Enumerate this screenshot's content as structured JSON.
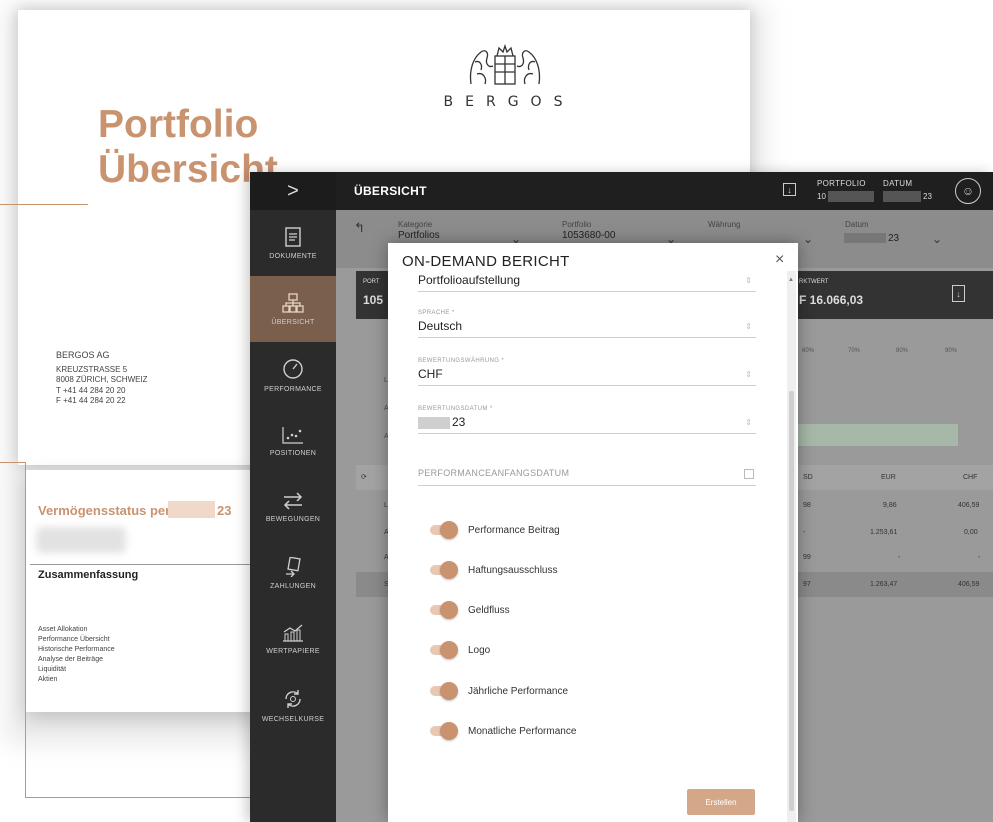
{
  "document": {
    "title_line1": "Portfolio",
    "title_line2": "Übersicht",
    "brand": "BERGOS",
    "address": {
      "firm": "BERGOS AG",
      "street": "KREUZSTRASSE 5",
      "city": "8008 ZÜRICH, SCHWEIZ",
      "phone": "T +41 44 284 20 20",
      "fax": "F +41 44 284 20 22"
    },
    "status_title": "Vermögensstatus per",
    "status_suffix": "23",
    "summary_title": "Zusammenfassung",
    "summary_items": [
      "Asset Allokation",
      "Performance Übersicht",
      "Historische Performance",
      "Analyse der Beiträge",
      "Liquidität",
      "Aktien"
    ]
  },
  "app": {
    "sidebar": {
      "toggle": ">",
      "items": [
        {
          "label": "DOKUMENTE",
          "icon": "document-icon"
        },
        {
          "label": "ÜBERSICHT",
          "icon": "sitemap-icon",
          "active": true
        },
        {
          "label": "PERFORMANCE",
          "icon": "gauge-icon"
        },
        {
          "label": "POSITIONEN",
          "icon": "scatter-icon"
        },
        {
          "label": "BEWEGUNGEN",
          "icon": "transfer-icon"
        },
        {
          "label": "ZAHLUNGEN",
          "icon": "payments-icon"
        },
        {
          "label": "WERTPAPIERE",
          "icon": "chart-icon"
        },
        {
          "label": "WECHSELKURSE",
          "icon": "exchange-icon"
        }
      ]
    },
    "topbar": {
      "title": "ÜBERSICHT",
      "portfolio_label": "PORTFOLIO",
      "portfolio_value": "10",
      "date_label": "DATUM",
      "date_value": "23"
    },
    "filters": {
      "category_label": "Kategorie",
      "category_value": "Portfolios",
      "portfolio_label": "Portfolio",
      "portfolio_value": "1053680-00",
      "currency_label": "Währung",
      "date_label": "Datum",
      "date_value": "23"
    },
    "card": {
      "left_label": "PORT",
      "left_value": "105",
      "right_label": "RKTWERT",
      "right_value": "F 16.066,03"
    },
    "behind": {
      "ticks": [
        "60%",
        "70%",
        "80%",
        "90%"
      ],
      "row_letters": [
        "L",
        "A",
        "A"
      ],
      "table_headers": [
        "SD",
        "EUR",
        "CHF"
      ],
      "rows": [
        {
          "k": "L",
          "a": "98",
          "b": "9,86",
          "c": "406,59"
        },
        {
          "k": "A",
          "a": "-",
          "b": "1.253,61",
          "c": "0,00"
        },
        {
          "k": "A",
          "a": "99",
          "b": "-",
          "c": "-"
        },
        {
          "k": "S",
          "a": "97",
          "b": "1.263,47",
          "c": "406,59"
        }
      ]
    }
  },
  "modal": {
    "title": "ON-DEMAND BERICHT",
    "close": "×",
    "fields": {
      "layout_value": "Portfolioaufstellung",
      "language_label": "SPRACHE *",
      "language_value": "Deutsch",
      "currency_label": "BEWERTUNGSWÄHRUNG *",
      "currency_value": "CHF",
      "valuation_date_label": "BEWERTUNGSDATUM *",
      "valuation_date_value": "23",
      "perf_start_placeholder": "PERFORMANCEANFANGSDATUM"
    },
    "toggles": [
      {
        "label": "Performance Beitrag",
        "on": true
      },
      {
        "label": "Haftungsausschluss",
        "on": true
      },
      {
        "label": "Geldfluss",
        "on": true
      },
      {
        "label": "Logo",
        "on": true
      },
      {
        "label": "Jährliche Performance",
        "on": true
      },
      {
        "label": "Monatliche Performance",
        "on": true
      }
    ],
    "submit_label": "Erstellen",
    "accent": "#c99370"
  }
}
